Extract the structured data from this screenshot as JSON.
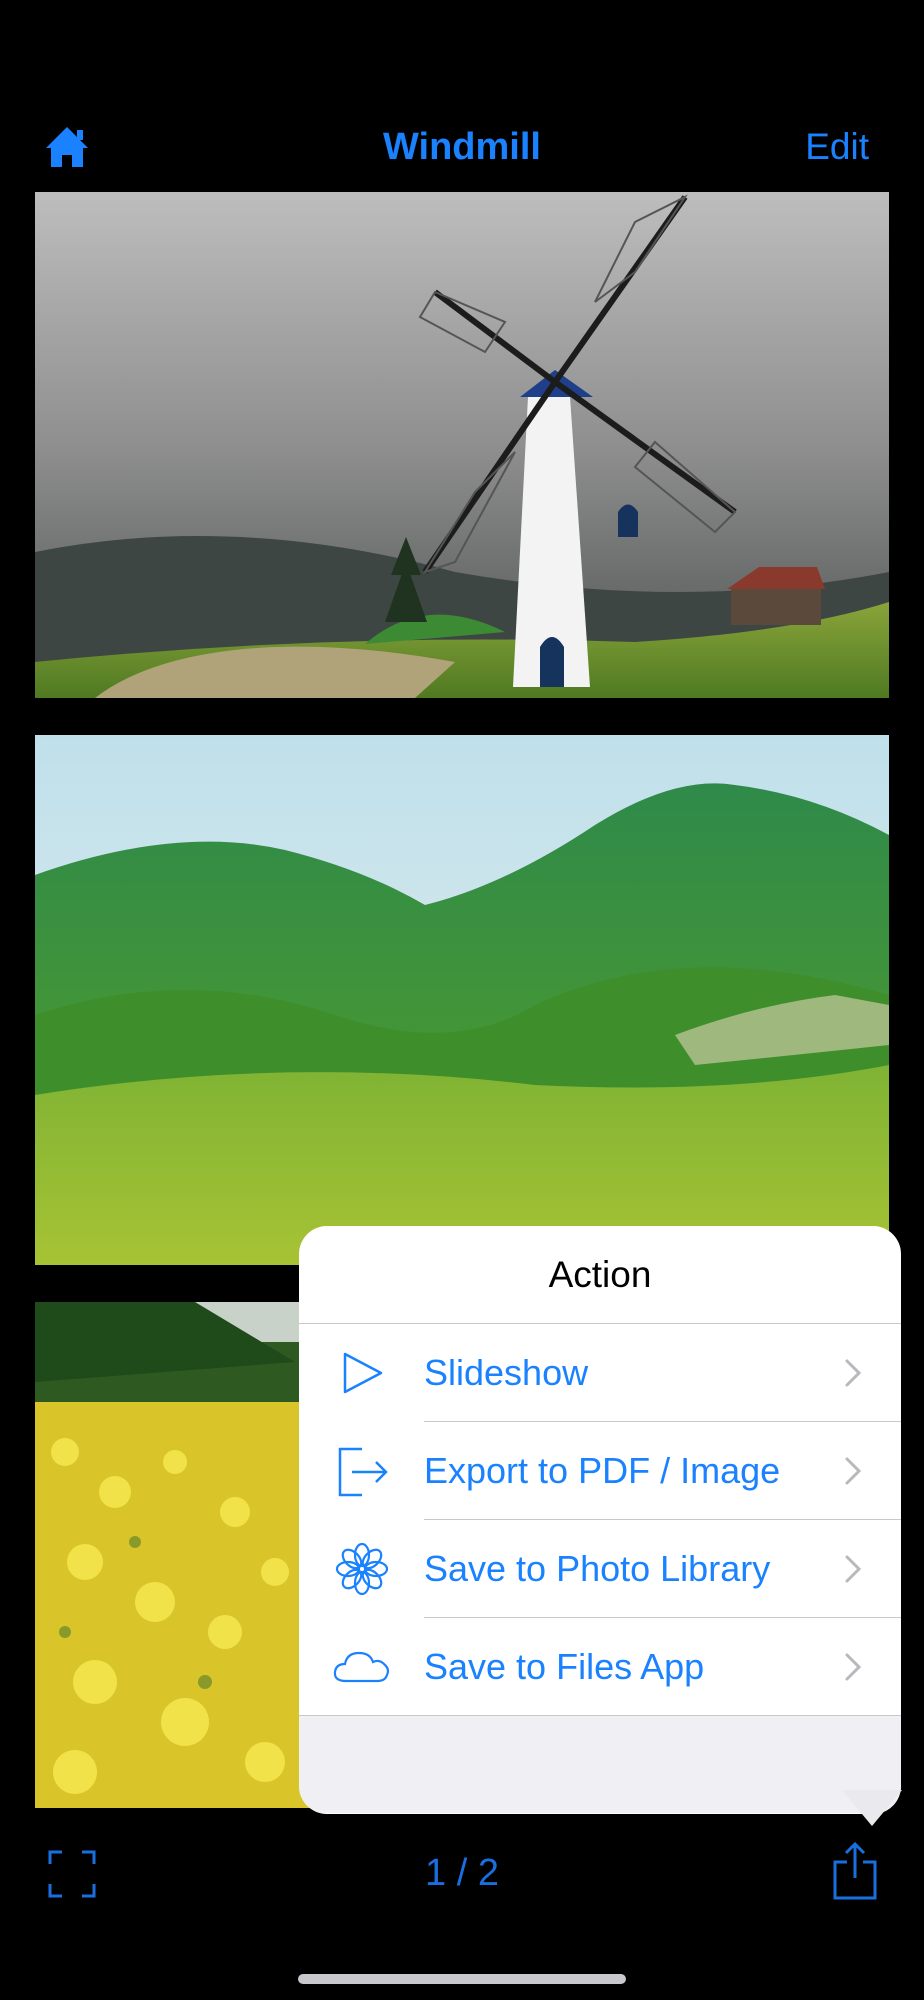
{
  "navbar": {
    "title": "Windmill",
    "edit_label": "Edit"
  },
  "action_sheet": {
    "title": "Action",
    "items": [
      {
        "label": "Slideshow",
        "icon": "play-icon"
      },
      {
        "label": "Export to PDF / Image",
        "icon": "export-icon"
      },
      {
        "label": "Save to Photo Library",
        "icon": "photos-flower-icon"
      },
      {
        "label": "Save to Files App",
        "icon": "cloud-icon"
      }
    ]
  },
  "toolbar": {
    "page_indicator": "1 / 2"
  },
  "colors": {
    "accent": "#1a82ff",
    "background": "#000000",
    "sheet": "#ffffff"
  }
}
